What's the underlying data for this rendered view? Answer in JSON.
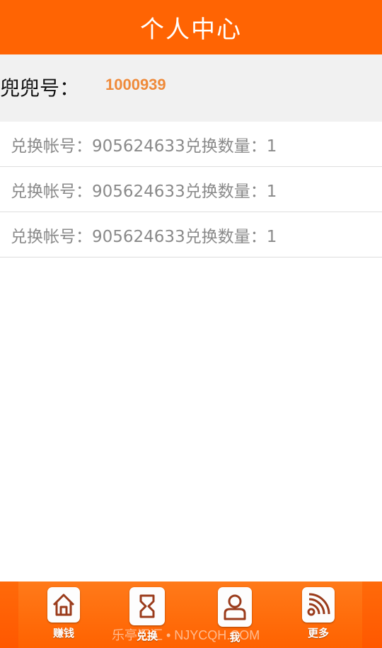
{
  "header": {
    "title": "个人中心"
  },
  "account": {
    "label": "兜兜号：",
    "value": "1000939"
  },
  "records": [
    {
      "text": "兑换帐号：905624633兑换数量：1"
    },
    {
      "text": "兑换帐号：905624633兑换数量：1"
    },
    {
      "text": "兑换帐号：905624633兑换数量：1"
    }
  ],
  "tabs": [
    {
      "label": "赚钱",
      "icon": "home-icon"
    },
    {
      "label": "兑换",
      "icon": "exchange-icon"
    },
    {
      "label": "我",
      "icon": "user-icon"
    },
    {
      "label": "更多",
      "icon": "rss-icon"
    }
  ],
  "watermark": "乐亭汇汇 • NJYCQH.COM",
  "colors": {
    "primary": "#ff6403",
    "account_value": "#ef8a3a",
    "icon_stroke": "#9a3b1b"
  }
}
